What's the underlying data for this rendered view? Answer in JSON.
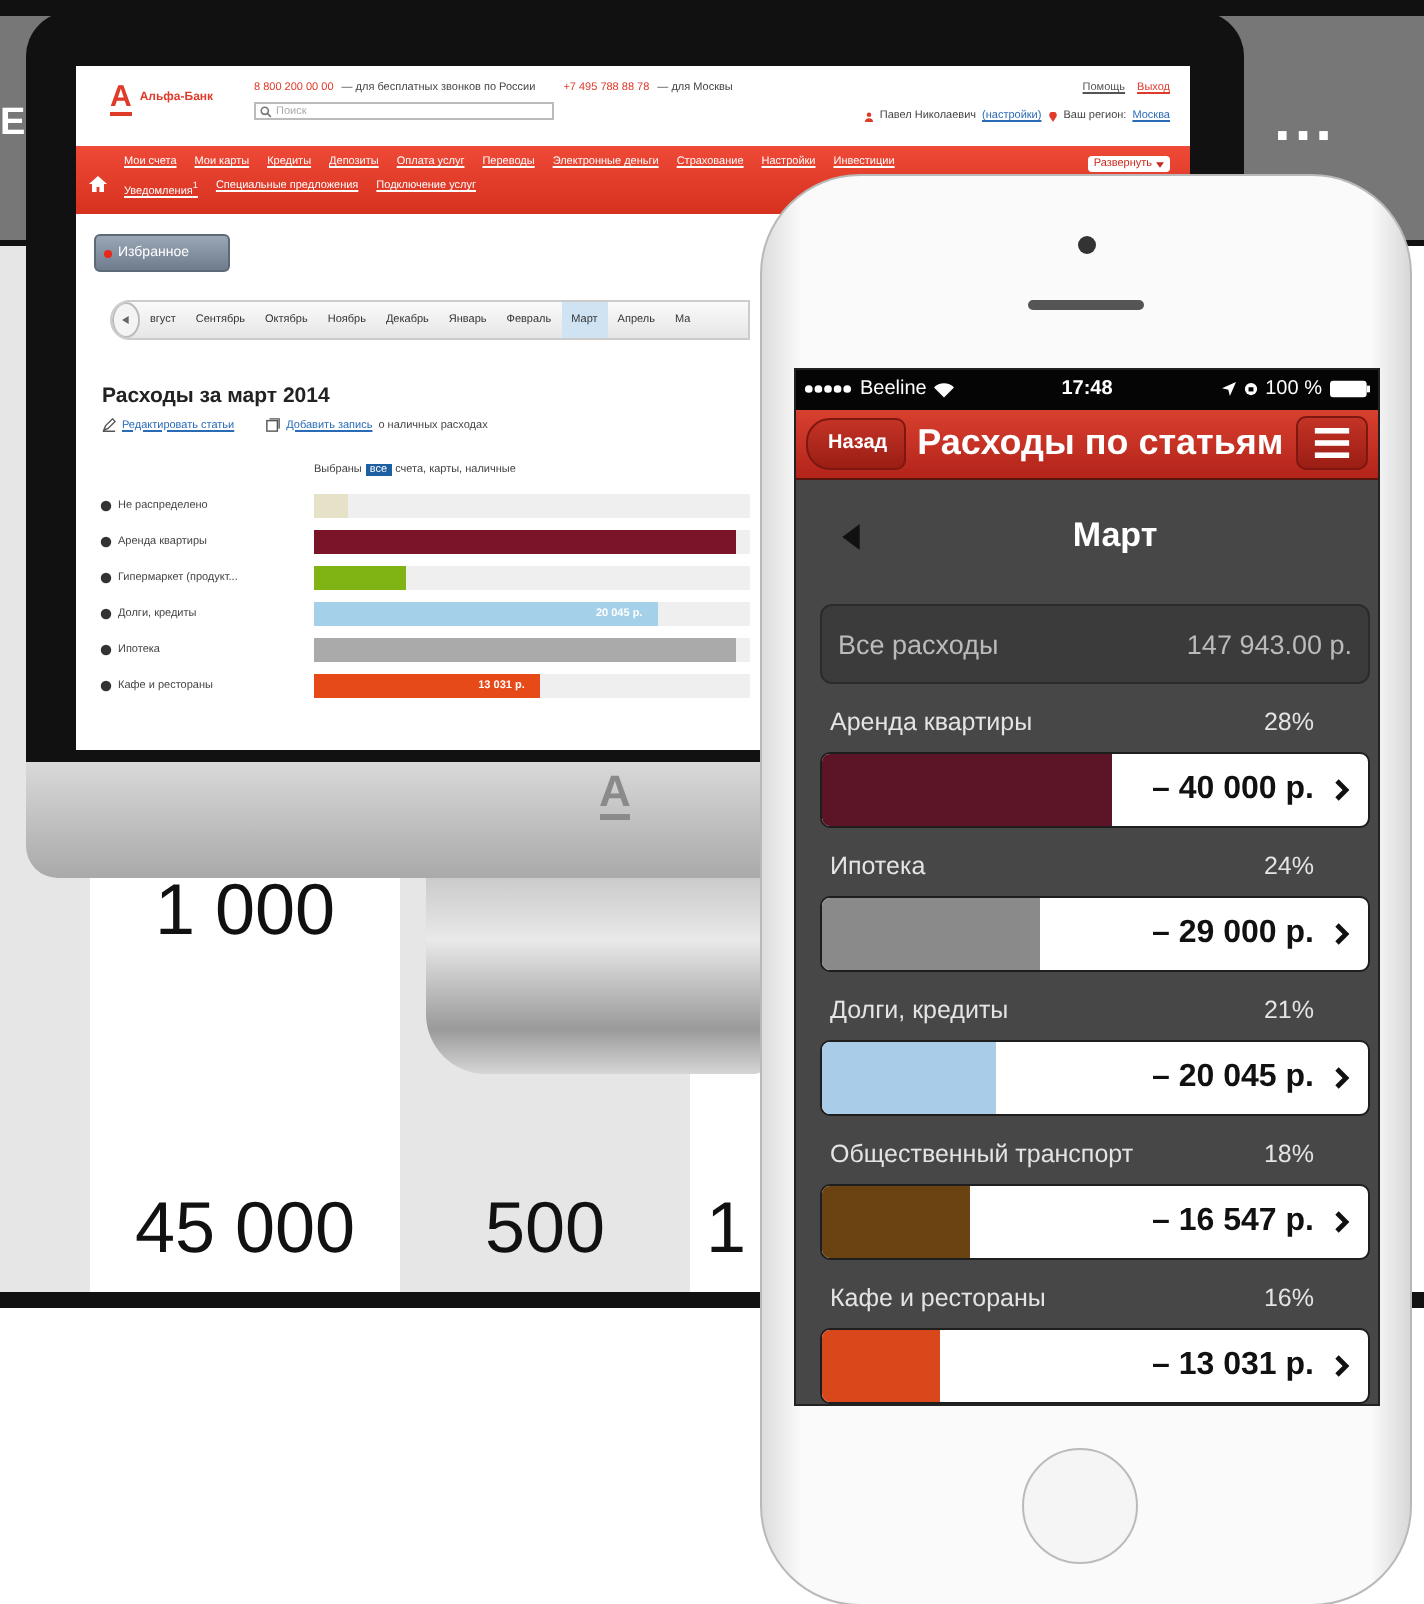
{
  "slide": {
    "heading_fragment": "Е",
    "ellipsis": "...",
    "table": {
      "row_1": [
        "1 000"
      ],
      "row_2": [
        "45 000",
        "500",
        "1"
      ]
    }
  },
  "monitor": {
    "chin_logo": "А"
  },
  "bank_site": {
    "logo_mark": "А",
    "logo": "Альфа-Банк",
    "hotlines": [
      {
        "number": "8 800 200 00 00",
        "note": "— для бесплатных звонков по России"
      },
      {
        "number": "+7 495 788 88 78",
        "note": "— для Москвы"
      }
    ],
    "search": {
      "placeholder": "Поиск"
    },
    "top_links": [
      "Помощь",
      "Выход"
    ],
    "user": "Павел Николаевич",
    "settings_link": "(настройки)",
    "region_label": "Ваш регион:",
    "region": "Москва",
    "menu": [
      "Мои счета",
      "Мои карты",
      "Кредиты",
      "Депозиты",
      "Оплата услуг",
      "Переводы",
      "Электронные деньги",
      "Страхование",
      "Настройки",
      "Инвестиции"
    ],
    "submenu": [
      "Уведомления$^{1}$",
      "Специальные предложения",
      "Подключение услуг"
    ],
    "expand_button": "Развернуть",
    "favorites_button": "Избранное",
    "months": [
      {
        "label": "вгуст",
        "selected": false
      },
      {
        "label": "Сентябрь",
        "selected": false
      },
      {
        "label": "Октябрь",
        "selected": false
      },
      {
        "label": "Ноябрь",
        "selected": false
      },
      {
        "label": "Декабрь",
        "selected": false
      },
      {
        "label": "Январь",
        "selected": false
      },
      {
        "label": "Февраль",
        "selected": false
      },
      {
        "label": "Март",
        "selected": true
      },
      {
        "label": "Апрель",
        "selected": false
      },
      {
        "label": "Ма",
        "selected": false
      }
    ],
    "heading": "Расходы за март 2014",
    "actions": [
      {
        "link": "Редактировать статьи"
      },
      {
        "link": "Добавить запись",
        "note": "о наличных расходах"
      }
    ],
    "filter": {
      "prefix": "Выбраны",
      "badge": "все",
      "suffix": "счета, карты, наличные"
    },
    "categories": [
      {
        "name": "Не распределено",
        "color": "#e6e2c8",
        "level": 0.08
      },
      {
        "name": "Аренда квартиры",
        "color": "#7a1428",
        "level": 0.97
      },
      {
        "name": "Гипермаркет (продукт...",
        "color": "#7fb414",
        "level": 0.21
      },
      {
        "name": "Долги, кредиты",
        "color": "#a5d0ea",
        "level": 0.79,
        "amount": "20 045 р."
      },
      {
        "name": "Ипотека",
        "color": "#aaaaaa",
        "level": 0.97
      },
      {
        "name": "Кафе и рестораны",
        "color": "#e64a19",
        "level": 0.52,
        "amount": "13 031 р."
      }
    ]
  },
  "phone": {
    "status": {
      "carrier": "Beeline",
      "time": "17:48",
      "battery": "100 %"
    },
    "back_button": "Назад",
    "title": "Расходы по статьям",
    "month": "Март",
    "total": {
      "label": "Все расходы",
      "value": "147 943.00 р."
    },
    "categories": [
      {
        "name": "Аренда квартиры",
        "share": "28%",
        "amount": "– 40 000 р.",
        "color": "#5c1526",
        "level": 0.53
      },
      {
        "name": "Ипотека",
        "share": "24%",
        "amount": "– 29 000 р.",
        "color": "#8a8a8a",
        "level": 0.4
      },
      {
        "name": "Долги, кредиты",
        "share": "21%",
        "amount": "– 20 045 р.",
        "color": "#a9cce8",
        "level": 0.32
      },
      {
        "name": "Общественный транспорт",
        "share": "18%",
        "amount": "– 16 547 р.",
        "color": "#6b4212",
        "level": 0.27
      },
      {
        "name": "Кафе и рестораны",
        "share": "16%",
        "amount": "– 13 031 р.",
        "color": "#d9481a",
        "level": 0.215
      }
    ]
  }
}
